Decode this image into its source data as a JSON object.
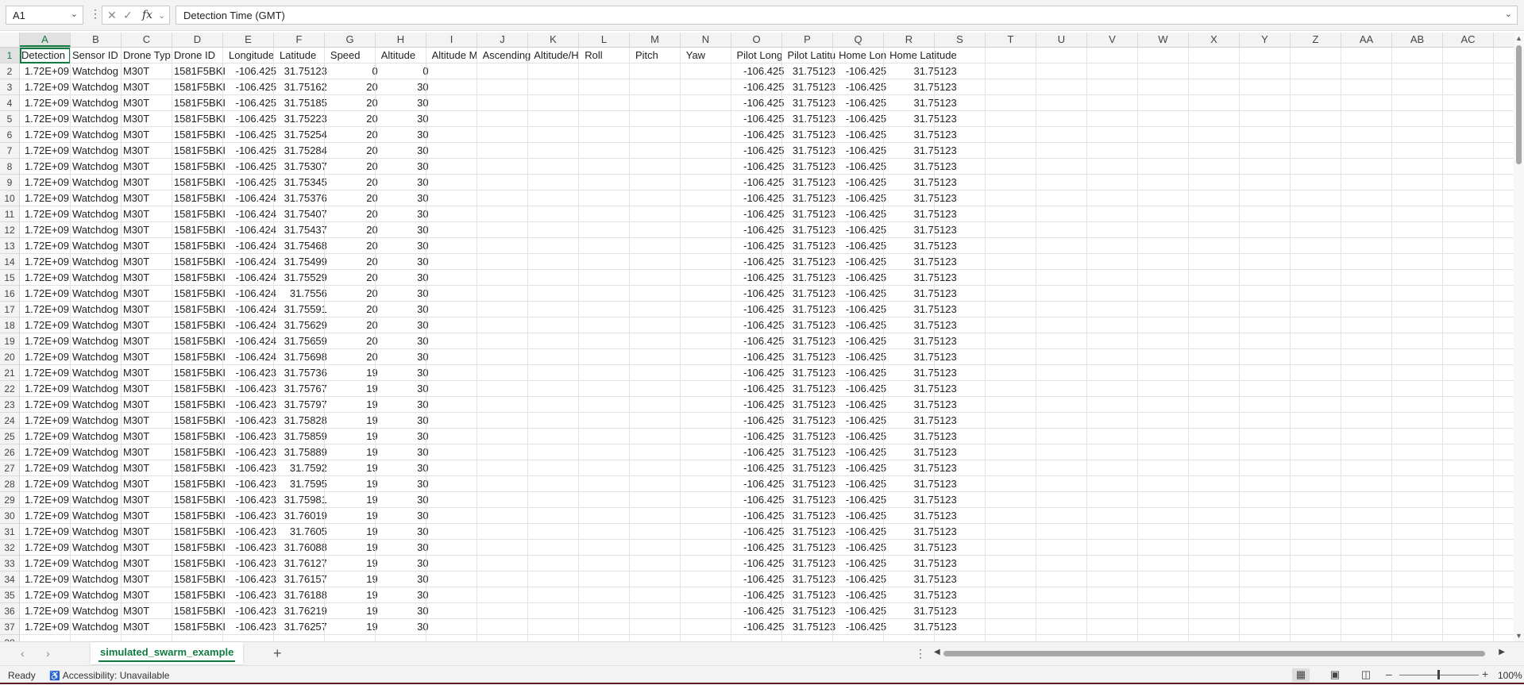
{
  "name_box": {
    "value": "A1"
  },
  "formula_bar": {
    "value": "Detection Time (GMT)"
  },
  "icons": {
    "cancel": "close-icon",
    "enter": "check-icon",
    "function": "fx-icon"
  },
  "columns": [
    "A",
    "B",
    "C",
    "D",
    "E",
    "F",
    "G",
    "H",
    "I",
    "J",
    "K",
    "L",
    "M",
    "N",
    "O",
    "P",
    "Q",
    "R",
    "S",
    "T",
    "U",
    "V",
    "W",
    "X",
    "Y",
    "Z",
    "AA",
    "AB",
    "AC"
  ],
  "headers": [
    "Detection",
    "Sensor ID",
    "Drone Typ",
    "Drone ID",
    "Longitude",
    "Latitude",
    "Speed",
    "Altitude",
    "Altitude M",
    "Ascending",
    "Altitude/H",
    "Roll",
    "Pitch",
    "Yaw",
    "Pilot Long",
    "Pilot Latitu",
    "Home Lon",
    "Home Latitude"
  ],
  "rows": [
    [
      "1.72E+09",
      "Watchdog",
      "M30T",
      "1581F5BKI",
      "-106.425",
      "31.75123",
      "0",
      "0",
      "",
      "",
      "",
      "",
      "",
      "",
      "-106.425",
      "31.75123",
      "-106.425",
      "31.75123"
    ],
    [
      "1.72E+09",
      "Watchdog",
      "M30T",
      "1581F5BKI",
      "-106.425",
      "31.75162",
      "20",
      "30",
      "",
      "",
      "",
      "",
      "",
      "",
      "-106.425",
      "31.75123",
      "-106.425",
      "31.75123"
    ],
    [
      "1.72E+09",
      "Watchdog",
      "M30T",
      "1581F5BKI",
      "-106.425",
      "31.75185",
      "20",
      "30",
      "",
      "",
      "",
      "",
      "",
      "",
      "-106.425",
      "31.75123",
      "-106.425",
      "31.75123"
    ],
    [
      "1.72E+09",
      "Watchdog",
      "M30T",
      "1581F5BKI",
      "-106.425",
      "31.75223",
      "20",
      "30",
      "",
      "",
      "",
      "",
      "",
      "",
      "-106.425",
      "31.75123",
      "-106.425",
      "31.75123"
    ],
    [
      "1.72E+09",
      "Watchdog",
      "M30T",
      "1581F5BKI",
      "-106.425",
      "31.75254",
      "20",
      "30",
      "",
      "",
      "",
      "",
      "",
      "",
      "-106.425",
      "31.75123",
      "-106.425",
      "31.75123"
    ],
    [
      "1.72E+09",
      "Watchdog",
      "M30T",
      "1581F5BKI",
      "-106.425",
      "31.75284",
      "20",
      "30",
      "",
      "",
      "",
      "",
      "",
      "",
      "-106.425",
      "31.75123",
      "-106.425",
      "31.75123"
    ],
    [
      "1.72E+09",
      "Watchdog",
      "M30T",
      "1581F5BKI",
      "-106.425",
      "31.75307",
      "20",
      "30",
      "",
      "",
      "",
      "",
      "",
      "",
      "-106.425",
      "31.75123",
      "-106.425",
      "31.75123"
    ],
    [
      "1.72E+09",
      "Watchdog",
      "M30T",
      "1581F5BKI",
      "-106.425",
      "31.75345",
      "20",
      "30",
      "",
      "",
      "",
      "",
      "",
      "",
      "-106.425",
      "31.75123",
      "-106.425",
      "31.75123"
    ],
    [
      "1.72E+09",
      "Watchdog",
      "M30T",
      "1581F5BKI",
      "-106.424",
      "31.75376",
      "20",
      "30",
      "",
      "",
      "",
      "",
      "",
      "",
      "-106.425",
      "31.75123",
      "-106.425",
      "31.75123"
    ],
    [
      "1.72E+09",
      "Watchdog",
      "M30T",
      "1581F5BKI",
      "-106.424",
      "31.75407",
      "20",
      "30",
      "",
      "",
      "",
      "",
      "",
      "",
      "-106.425",
      "31.75123",
      "-106.425",
      "31.75123"
    ],
    [
      "1.72E+09",
      "Watchdog",
      "M30T",
      "1581F5BKI",
      "-106.424",
      "31.75437",
      "20",
      "30",
      "",
      "",
      "",
      "",
      "",
      "",
      "-106.425",
      "31.75123",
      "-106.425",
      "31.75123"
    ],
    [
      "1.72E+09",
      "Watchdog",
      "M30T",
      "1581F5BKI",
      "-106.424",
      "31.75468",
      "20",
      "30",
      "",
      "",
      "",
      "",
      "",
      "",
      "-106.425",
      "31.75123",
      "-106.425",
      "31.75123"
    ],
    [
      "1.72E+09",
      "Watchdog",
      "M30T",
      "1581F5BKI",
      "-106.424",
      "31.75499",
      "20",
      "30",
      "",
      "",
      "",
      "",
      "",
      "",
      "-106.425",
      "31.75123",
      "-106.425",
      "31.75123"
    ],
    [
      "1.72E+09",
      "Watchdog",
      "M30T",
      "1581F5BKI",
      "-106.424",
      "31.75529",
      "20",
      "30",
      "",
      "",
      "",
      "",
      "",
      "",
      "-106.425",
      "31.75123",
      "-106.425",
      "31.75123"
    ],
    [
      "1.72E+09",
      "Watchdog",
      "M30T",
      "1581F5BKI",
      "-106.424",
      "31.7556",
      "20",
      "30",
      "",
      "",
      "",
      "",
      "",
      "",
      "-106.425",
      "31.75123",
      "-106.425",
      "31.75123"
    ],
    [
      "1.72E+09",
      "Watchdog",
      "M30T",
      "1581F5BKI",
      "-106.424",
      "31.75591",
      "20",
      "30",
      "",
      "",
      "",
      "",
      "",
      "",
      "-106.425",
      "31.75123",
      "-106.425",
      "31.75123"
    ],
    [
      "1.72E+09",
      "Watchdog",
      "M30T",
      "1581F5BKI",
      "-106.424",
      "31.75629",
      "20",
      "30",
      "",
      "",
      "",
      "",
      "",
      "",
      "-106.425",
      "31.75123",
      "-106.425",
      "31.75123"
    ],
    [
      "1.72E+09",
      "Watchdog",
      "M30T",
      "1581F5BKI",
      "-106.424",
      "31.75659",
      "20",
      "30",
      "",
      "",
      "",
      "",
      "",
      "",
      "-106.425",
      "31.75123",
      "-106.425",
      "31.75123"
    ],
    [
      "1.72E+09",
      "Watchdog",
      "M30T",
      "1581F5BKI",
      "-106.424",
      "31.75698",
      "20",
      "30",
      "",
      "",
      "",
      "",
      "",
      "",
      "-106.425",
      "31.75123",
      "-106.425",
      "31.75123"
    ],
    [
      "1.72E+09",
      "Watchdog",
      "M30T",
      "1581F5BKI",
      "-106.423",
      "31.75736",
      "19",
      "30",
      "",
      "",
      "",
      "",
      "",
      "",
      "-106.425",
      "31.75123",
      "-106.425",
      "31.75123"
    ],
    [
      "1.72E+09",
      "Watchdog",
      "M30T",
      "1581F5BKI",
      "-106.423",
      "31.75767",
      "19",
      "30",
      "",
      "",
      "",
      "",
      "",
      "",
      "-106.425",
      "31.75123",
      "-106.425",
      "31.75123"
    ],
    [
      "1.72E+09",
      "Watchdog",
      "M30T",
      "1581F5BKI",
      "-106.423",
      "31.75797",
      "19",
      "30",
      "",
      "",
      "",
      "",
      "",
      "",
      "-106.425",
      "31.75123",
      "-106.425",
      "31.75123"
    ],
    [
      "1.72E+09",
      "Watchdog",
      "M30T",
      "1581F5BKI",
      "-106.423",
      "31.75828",
      "19",
      "30",
      "",
      "",
      "",
      "",
      "",
      "",
      "-106.425",
      "31.75123",
      "-106.425",
      "31.75123"
    ],
    [
      "1.72E+09",
      "Watchdog",
      "M30T",
      "1581F5BKI",
      "-106.423",
      "31.75859",
      "19",
      "30",
      "",
      "",
      "",
      "",
      "",
      "",
      "-106.425",
      "31.75123",
      "-106.425",
      "31.75123"
    ],
    [
      "1.72E+09",
      "Watchdog",
      "M30T",
      "1581F5BKI",
      "-106.423",
      "31.75889",
      "19",
      "30",
      "",
      "",
      "",
      "",
      "",
      "",
      "-106.425",
      "31.75123",
      "-106.425",
      "31.75123"
    ],
    [
      "1.72E+09",
      "Watchdog",
      "M30T",
      "1581F5BKI",
      "-106.423",
      "31.7592",
      "19",
      "30",
      "",
      "",
      "",
      "",
      "",
      "",
      "-106.425",
      "31.75123",
      "-106.425",
      "31.75123"
    ],
    [
      "1.72E+09",
      "Watchdog",
      "M30T",
      "1581F5BKI",
      "-106.423",
      "31.7595",
      "19",
      "30",
      "",
      "",
      "",
      "",
      "",
      "",
      "-106.425",
      "31.75123",
      "-106.425",
      "31.75123"
    ],
    [
      "1.72E+09",
      "Watchdog",
      "M30T",
      "1581F5BKI",
      "-106.423",
      "31.75981",
      "19",
      "30",
      "",
      "",
      "",
      "",
      "",
      "",
      "-106.425",
      "31.75123",
      "-106.425",
      "31.75123"
    ],
    [
      "1.72E+09",
      "Watchdog",
      "M30T",
      "1581F5BKI",
      "-106.423",
      "31.76019",
      "19",
      "30",
      "",
      "",
      "",
      "",
      "",
      "",
      "-106.425",
      "31.75123",
      "-106.425",
      "31.75123"
    ],
    [
      "1.72E+09",
      "Watchdog",
      "M30T",
      "1581F5BKI",
      "-106.423",
      "31.7605",
      "19",
      "30",
      "",
      "",
      "",
      "",
      "",
      "",
      "-106.425",
      "31.75123",
      "-106.425",
      "31.75123"
    ],
    [
      "1.72E+09",
      "Watchdog",
      "M30T",
      "1581F5BKI",
      "-106.423",
      "31.76088",
      "19",
      "30",
      "",
      "",
      "",
      "",
      "",
      "",
      "-106.425",
      "31.75123",
      "-106.425",
      "31.75123"
    ],
    [
      "1.72E+09",
      "Watchdog",
      "M30T",
      "1581F5BKI",
      "-106.423",
      "31.76127",
      "19",
      "30",
      "",
      "",
      "",
      "",
      "",
      "",
      "-106.425",
      "31.75123",
      "-106.425",
      "31.75123"
    ],
    [
      "1.72E+09",
      "Watchdog",
      "M30T",
      "1581F5BKI",
      "-106.423",
      "31.76157",
      "19",
      "30",
      "",
      "",
      "",
      "",
      "",
      "",
      "-106.425",
      "31.75123",
      "-106.425",
      "31.75123"
    ],
    [
      "1.72E+09",
      "Watchdog",
      "M30T",
      "1581F5BKI",
      "-106.423",
      "31.76188",
      "19",
      "30",
      "",
      "",
      "",
      "",
      "",
      "",
      "-106.425",
      "31.75123",
      "-106.425",
      "31.75123"
    ],
    [
      "1.72E+09",
      "Watchdog",
      "M30T",
      "1581F5BKI",
      "-106.423",
      "31.76219",
      "19",
      "30",
      "",
      "",
      "",
      "",
      "",
      "",
      "-106.425",
      "31.75123",
      "-106.425",
      "31.75123"
    ],
    [
      "1.72E+09",
      "Watchdog",
      "M30T",
      "1581F5BKI",
      "-106.423",
      "31.76257",
      "19",
      "30",
      "",
      "",
      "",
      "",
      "",
      "",
      "-106.425",
      "31.75123",
      "-106.425",
      "31.75123"
    ]
  ],
  "sheet_tabs": {
    "active": "simulated_swarm_example"
  },
  "status": {
    "ready": "Ready",
    "accessibility": "Accessibility: Unavailable",
    "zoom": "100%",
    "zoom_fraction": 0.5
  },
  "colors": {
    "accent": "#107c41"
  }
}
